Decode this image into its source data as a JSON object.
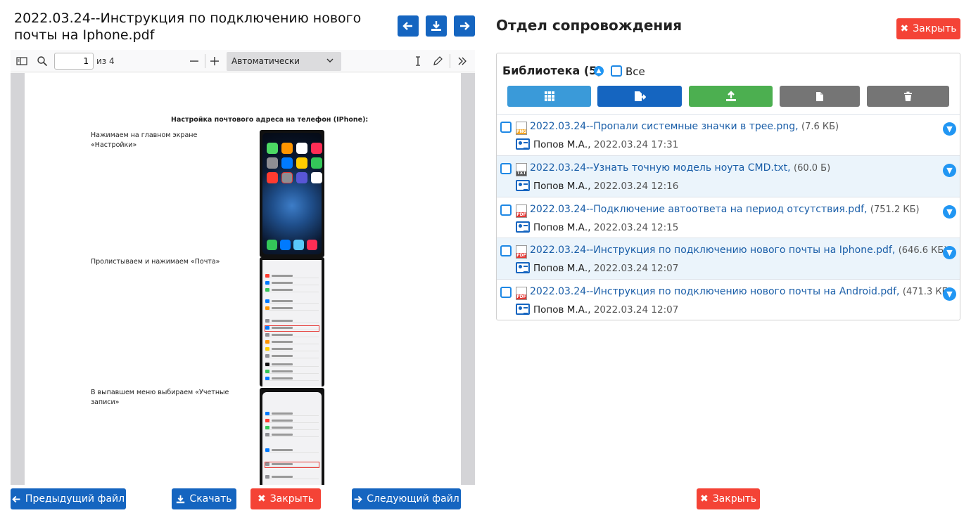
{
  "viewer": {
    "title": "2022.03.24--Инструкция по подключению нового почты на Iphone.pdf",
    "page_current": "1",
    "page_total_label": "из 4",
    "zoom": "Автоматически",
    "document": {
      "heading": "Настройка почтового адреса на телефон (IPhone):",
      "steps": [
        "Нажимаем на главном экране «Настройки»",
        "Пролистываем и нажимаем «Почта»",
        "В выпавшем меню выбираем «Учетные записи»"
      ]
    }
  },
  "footer_left": {
    "prev_label": "Предыдущий файл",
    "download_label": "Скачать",
    "close_label": "Закрыть",
    "next_label": "Следующий файл"
  },
  "panel": {
    "title": "Отдел сопровождения",
    "close_label": "Закрыть",
    "library_label": "Библиотека (5)",
    "all_label": "Все",
    "footer_close_label": "Закрыть"
  },
  "files": [
    {
      "name": "2022.03.24--Пропали системные значки в трее.png",
      "size": "(7.6 КБ)",
      "user": "Попов М.А.",
      "date": "2022.03.24 17:31",
      "type": "PNG",
      "type_color": "#f5a623"
    },
    {
      "name": "2022.03.24--Узнать точную модель ноута CMD.txt",
      "size": "(60.0 Б)",
      "user": "Попов М.А.",
      "date": "2022.03.24 12:16",
      "type": "TXT",
      "type_color": "#555555"
    },
    {
      "name": "2022.03.24--Подключение автоответа на период отсутствия.pdf",
      "size": "(751.2 КБ)",
      "user": "Попов М.А.",
      "date": "2022.03.24 12:15",
      "type": "PDF",
      "type_color": "#e53935"
    },
    {
      "name": "2022.03.24--Инструкция по подключению нового почты на Iphone.pdf",
      "size": "(646.6 КБ)",
      "user": "Попов М.А.",
      "date": "2022.03.24 12:07",
      "type": "PDF",
      "type_color": "#e53935"
    },
    {
      "name": "2022.03.24--Инструкция по подключению нового почты на Android.pdf",
      "size": "(471.3 КБ)",
      "user": "Попов М.А.",
      "date": "2022.03.24 12:07",
      "type": "PDF",
      "type_color": "#e53935"
    }
  ],
  "colors": {
    "primary": "#1565c0",
    "light_blue": "#3a9ad9",
    "green": "#4caf50",
    "gray": "#757575",
    "danger": "#f44336"
  }
}
